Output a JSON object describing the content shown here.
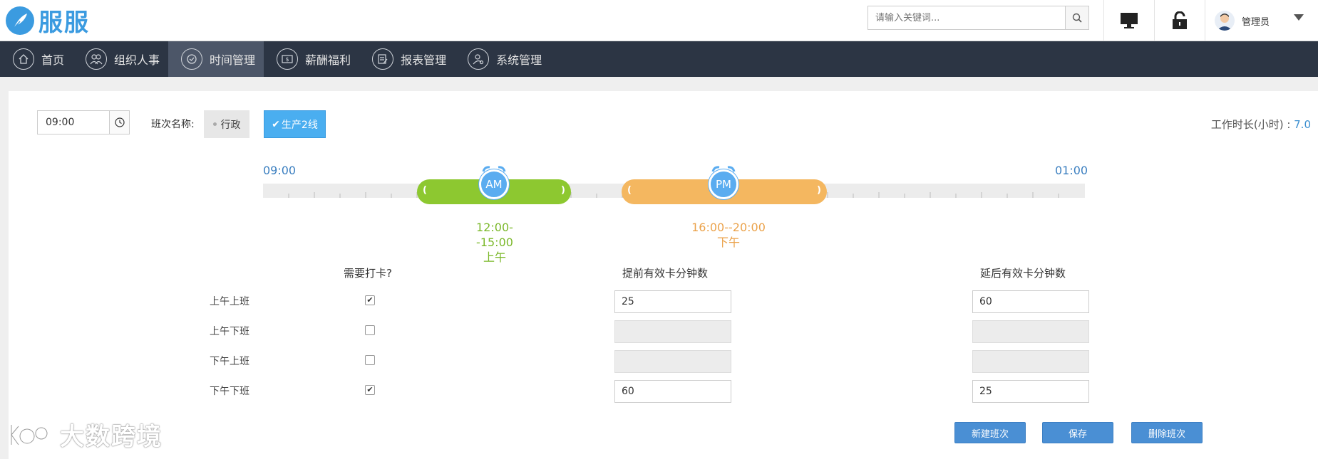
{
  "app": {
    "name": "服服"
  },
  "search": {
    "placeholder": "请输入关键词..."
  },
  "user": {
    "name": "管理员"
  },
  "nav": [
    {
      "label": "首页",
      "icon": "home-icon"
    },
    {
      "label": "组织人事",
      "icon": "people-icon"
    },
    {
      "label": "时间管理",
      "icon": "clock-icon",
      "active": true
    },
    {
      "label": "薪酬福利",
      "icon": "money-icon"
    },
    {
      "label": "报表管理",
      "icon": "report-icon"
    },
    {
      "label": "系统管理",
      "icon": "user-settings-icon"
    }
  ],
  "shift": {
    "time_value": "09:00",
    "name_label": "班次名称:",
    "options": [
      "行政",
      "生产2线"
    ],
    "selected": "生产2线",
    "work_hours_label": "工作时长(小时) : ",
    "work_hours_value": "7.0"
  },
  "timeline": {
    "start": "09:00",
    "end": "01:00",
    "am": {
      "badge": "AM",
      "range": "12:00--15:00",
      "label": "上午",
      "color": "#8dc830"
    },
    "pm": {
      "badge": "PM",
      "range": "16:00--20:00",
      "label": "下午",
      "color": "#f4b760"
    }
  },
  "punch_table": {
    "headers": [
      "需要打卡?",
      "提前有效卡分钟数",
      "延后有效卡分钟数"
    ],
    "rows": [
      {
        "label": "上午上班",
        "checked": true,
        "before": "25",
        "after": "60"
      },
      {
        "label": "上午下班",
        "checked": false,
        "before": "",
        "after": ""
      },
      {
        "label": "下午上班",
        "checked": false,
        "before": "",
        "after": ""
      },
      {
        "label": "下午下班",
        "checked": true,
        "before": "60",
        "after": "25"
      }
    ]
  },
  "actions": {
    "new": "新建班次",
    "save": "保存",
    "delete": "删除班次"
  },
  "watermark": {
    "text": "大数跨境"
  },
  "colors": {
    "primary": "#4a8fd4",
    "nav_bg": "#2c3544",
    "accent": "#3b9be0"
  }
}
